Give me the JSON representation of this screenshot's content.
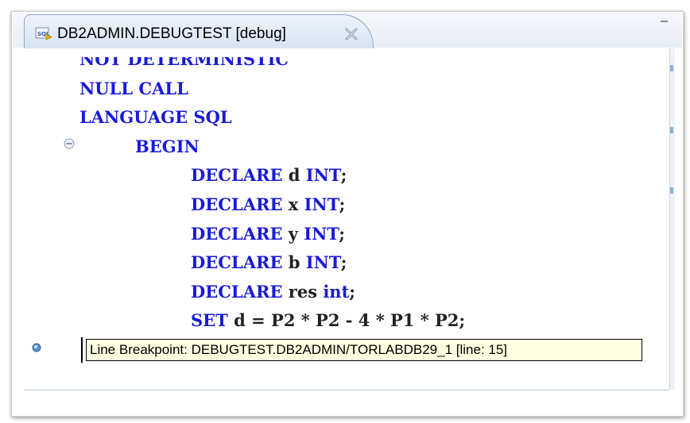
{
  "editor_tab": {
    "title": "DB2ADMIN.DEBUGTEST [debug]",
    "icon": "sql-file-icon",
    "close_icon": "close-icon"
  },
  "code": {
    "lines": [
      {
        "indent": 0,
        "tokens": [
          {
            "t": "NOT DETERMINISTIC",
            "k": "kw"
          }
        ]
      },
      {
        "indent": 0,
        "tokens": [
          {
            "t": "NULL CALL",
            "k": "kw"
          }
        ]
      },
      {
        "indent": 0,
        "tokens": [
          {
            "t": "LANGUAGE SQL",
            "k": "kw"
          }
        ]
      },
      {
        "indent": 1,
        "tokens": [
          {
            "t": "BEGIN",
            "k": "kw"
          }
        ]
      },
      {
        "indent": 2,
        "tokens": [
          {
            "t": "DECLARE",
            "k": "kw"
          },
          {
            "t": " d ",
            "k": "id"
          },
          {
            "t": "INT",
            "k": "kw"
          },
          {
            "t": ";",
            "k": "id"
          }
        ]
      },
      {
        "indent": 2,
        "tokens": [
          {
            "t": "DECLARE",
            "k": "kw"
          },
          {
            "t": " x ",
            "k": "id"
          },
          {
            "t": "INT",
            "k": "kw"
          },
          {
            "t": ";",
            "k": "id"
          }
        ]
      },
      {
        "indent": 2,
        "tokens": [
          {
            "t": "DECLARE",
            "k": "kw"
          },
          {
            "t": " y ",
            "k": "id"
          },
          {
            "t": "INT",
            "k": "kw"
          },
          {
            "t": ";",
            "k": "id"
          }
        ]
      },
      {
        "indent": 2,
        "tokens": [
          {
            "t": "DECLARE",
            "k": "kw"
          },
          {
            "t": " b ",
            "k": "id"
          },
          {
            "t": "INT",
            "k": "kw"
          },
          {
            "t": ";",
            "k": "id"
          }
        ]
      },
      {
        "indent": 2,
        "tokens": [
          {
            "t": "DECLARE",
            "k": "kw"
          },
          {
            "t": " res ",
            "k": "id"
          },
          {
            "t": "int",
            "k": "kw"
          },
          {
            "t": ";",
            "k": "id"
          }
        ]
      },
      {
        "indent": 2,
        "tokens": [
          {
            "t": "SET",
            "k": "kw"
          },
          {
            "t": " d = P2 * P2 - 4 * P1 * P2;",
            "k": "id"
          }
        ]
      }
    ]
  },
  "breakpoint_tooltip": {
    "text": "Line Breakpoint: DEBUGTEST.DB2ADMIN/TORLABDB29_1 [line: 15]"
  },
  "colors": {
    "keyword": "#1a1ad8",
    "identifier": "#222222",
    "tooltip_bg": "#ffffe1",
    "tab_border": "#8fa6c6"
  }
}
